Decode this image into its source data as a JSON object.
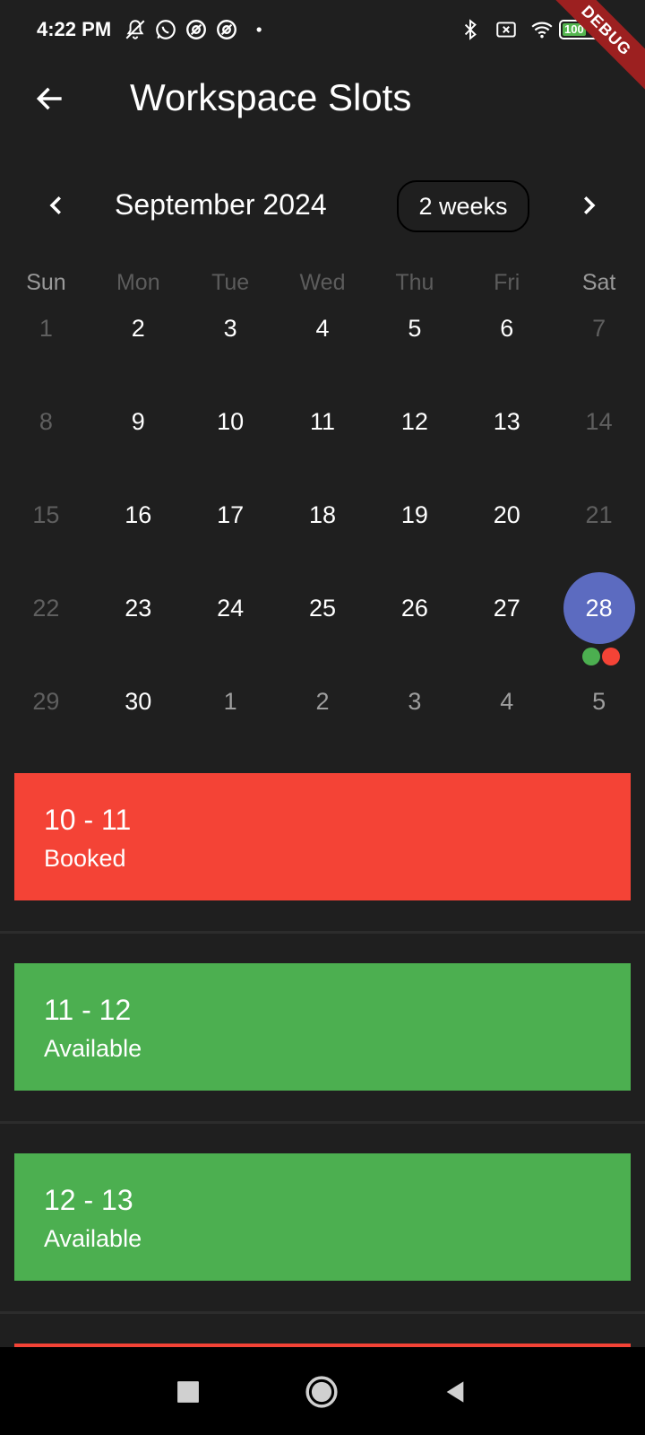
{
  "status_bar": {
    "time": "4:22 PM",
    "battery_text": "100",
    "icons_left": [
      "bell-off-icon",
      "whatsapp-icon",
      "at-icon",
      "at-icon",
      "dot-icon"
    ],
    "icons_right": [
      "bluetooth-icon",
      "no-sim-icon",
      "wifi-icon",
      "battery-icon"
    ]
  },
  "debug_banner": "DEBUG",
  "app_bar": {
    "title": "Workspace Slots"
  },
  "calendar": {
    "month_label": "September 2024",
    "format_button": "2 weeks",
    "weekdays": [
      "Sun",
      "Mon",
      "Tue",
      "Wed",
      "Thu",
      "Fri",
      "Sat"
    ],
    "weeks": [
      [
        "1",
        "2",
        "3",
        "4",
        "5",
        "6",
        "7"
      ],
      [
        "8",
        "9",
        "10",
        "11",
        "12",
        "13",
        "14"
      ],
      [
        "15",
        "16",
        "17",
        "18",
        "19",
        "20",
        "21"
      ],
      [
        "22",
        "23",
        "24",
        "25",
        "26",
        "27",
        "28"
      ],
      [
        "29",
        "30",
        "1",
        "2",
        "3",
        "4",
        "5"
      ]
    ],
    "selected_day": "28",
    "marker_colors": [
      "#4caf50",
      "#f44336"
    ]
  },
  "slots": [
    {
      "time": "10 - 11",
      "status": "Booked",
      "color": "#f44336"
    },
    {
      "time": "11 - 12",
      "status": "Available",
      "color": "#4caf50"
    },
    {
      "time": "12 - 13",
      "status": "Available",
      "color": "#4caf50"
    }
  ],
  "colors": {
    "background": "#1f1f1f",
    "selected_day": "#5c6bc0",
    "booked": "#f44336",
    "available": "#4caf50"
  }
}
